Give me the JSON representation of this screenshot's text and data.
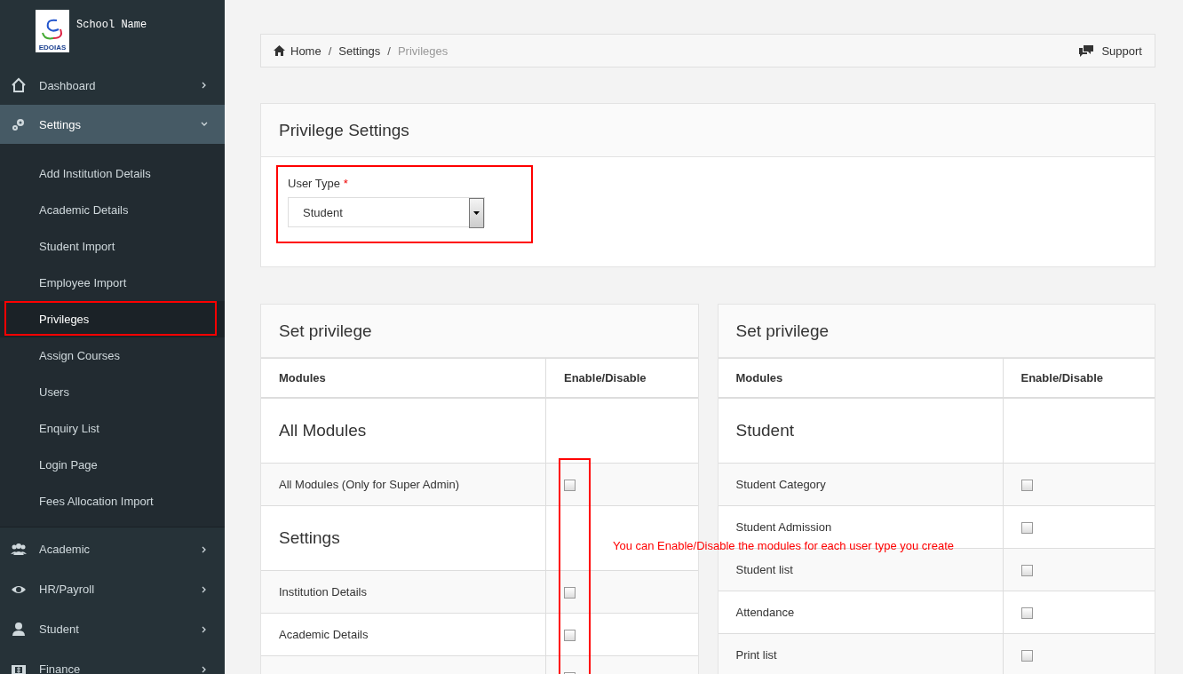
{
  "brand": {
    "name": "School Name",
    "logo_text": "EDOIAS"
  },
  "sidebar": {
    "items": [
      {
        "label": "Dashboard",
        "expanded": false,
        "selected": false
      },
      {
        "label": "Settings",
        "expanded": true,
        "selected": true,
        "children": [
          {
            "label": "Add Institution Details",
            "selected": false
          },
          {
            "label": "Academic Details",
            "selected": false
          },
          {
            "label": "Student Import",
            "selected": false
          },
          {
            "label": "Employee Import",
            "selected": false
          },
          {
            "label": "Privileges",
            "selected": true
          },
          {
            "label": "Assign Courses",
            "selected": false
          },
          {
            "label": "Users",
            "selected": false
          },
          {
            "label": "Enquiry List",
            "selected": false
          },
          {
            "label": "Login Page",
            "selected": false
          },
          {
            "label": "Fees Allocation Import",
            "selected": false
          }
        ]
      },
      {
        "label": "Academic",
        "expanded": false,
        "selected": false
      },
      {
        "label": "HR/Payroll",
        "expanded": false,
        "selected": false
      },
      {
        "label": "Student",
        "expanded": false,
        "selected": false
      },
      {
        "label": "Finance",
        "expanded": false,
        "selected": false
      }
    ]
  },
  "breadcrumb": [
    {
      "label": "Home"
    },
    {
      "separator": "/",
      "label": "Settings"
    },
    {
      "separator": "/",
      "label": "Privileges"
    }
  ],
  "support": "Support",
  "privilege_settings": {
    "title": "Privilege Settings",
    "field_label": "User Type",
    "required_mark": "*",
    "value": "Student"
  },
  "tables": [
    {
      "title": "Set privilege",
      "columns": [
        "Modules",
        "Enable/Disable"
      ],
      "rows": [
        {
          "kind": "section",
          "label": "All Modules"
        },
        {
          "kind": "item",
          "label": "All Modules (Only for Super Admin)",
          "checked": false
        },
        {
          "kind": "section",
          "label": "Settings"
        },
        {
          "kind": "item",
          "label": "Institution Details",
          "checked": false
        },
        {
          "kind": "item",
          "label": "Academic Details",
          "checked": false
        },
        {
          "kind": "item",
          "checked": false
        }
      ]
    },
    {
      "title": "Set privilege",
      "columns": [
        "Modules",
        "Enable/Disable"
      ],
      "rows": [
        {
          "kind": "section",
          "label": "Student"
        },
        {
          "kind": "item",
          "label": "Student Category",
          "checked": false
        },
        {
          "kind": "item",
          "label": "Student Admission",
          "checked": false
        },
        {
          "kind": "item",
          "label": "Student list",
          "checked": false
        },
        {
          "kind": "item",
          "label": "Attendance",
          "checked": false
        },
        {
          "kind": "item",
          "label": "Print list",
          "checked": false
        }
      ]
    }
  ],
  "annotation": "You can Enable/Disable the modules for each user type you create"
}
